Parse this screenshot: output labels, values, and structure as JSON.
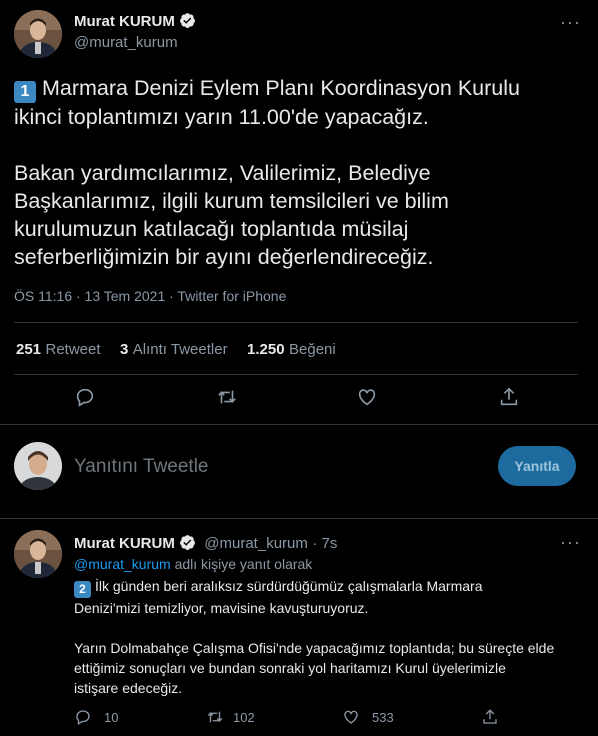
{
  "tweet": {
    "author_name": "Murat KURUM",
    "author_handle": "@murat_kurum",
    "badge": "1",
    "line1": "Marmara Denizi Eylem Planı Koordinasyon Kurulu",
    "line2": "ikinci toplantımızı yarın 11.00'de yapacağız.",
    "para2_line1": "Bakan yardımcılarımız, Valilerimiz, Belediye",
    "para2_line2": "Başkanlarımız, ilgili kurum temsilcileri ve bilim",
    "para2_line3": "kurulumuzun katılacağı toplantıda müsilaj",
    "para2_line4": "seferberliğimizin bir ayını değerlendireceğiz.",
    "meta": "ÖS 11:16 · 13 Tem 2021 · Twitter for iPhone",
    "stats": {
      "retweets": "251",
      "retweets_label": "Retweet",
      "quotes": "3",
      "quotes_label": "Alıntı Tweetler",
      "likes": "1.250",
      "likes_label": "Beğeni"
    },
    "icons": [
      "reply-icon",
      "retweet-icon",
      "like-icon",
      "share-icon"
    ]
  },
  "reply_box": {
    "placeholder": "Yanıtını Tweetle",
    "button_label": "Yanıtla"
  },
  "reply_tweet": {
    "author_name": "Murat KURUM",
    "author_handle": "@murat_kurum",
    "time": "· 7s",
    "reply_to_handle": "@murat_kurum",
    "reply_to_suffix": "adlı kişiye yanıt olarak",
    "badge": "2",
    "line1": "İlk günden beri aralıksız sürdürdüğümüz çalışmalarla Marmara",
    "line2": "Denizi'mizi temizliyor, mavisine kavuşturuyoruz.",
    "para2_line1": "Yarın Dolmabahçe Çalışma Ofisi'nde yapacağımız toplantıda; bu süreçte elde",
    "para2_line2": "ettiğimiz sonuçları ve bundan sonraki yol haritamızı Kurul üyelerimizle",
    "para2_line3": "istişare edeceğiz.",
    "replies": "10",
    "retweets": "102",
    "likes": "533"
  },
  "colors": {
    "background": "#000000",
    "text": "#e7e9ea",
    "secondary": "#8b98a5",
    "link": "#1d9bf0",
    "divider": "#2f3336",
    "button": "#1d6a9e"
  }
}
